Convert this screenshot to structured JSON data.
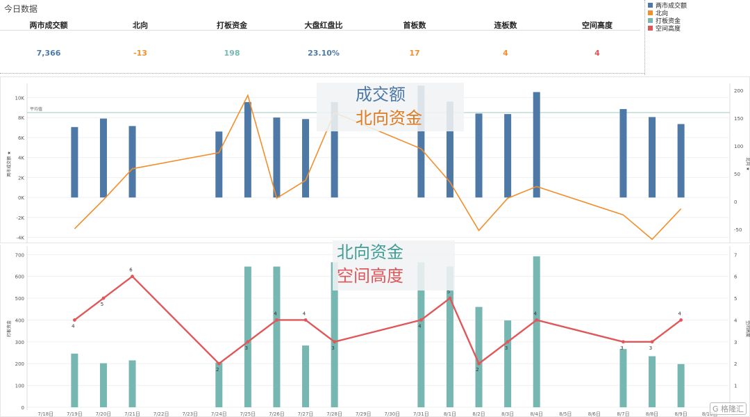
{
  "page_title": "今日数据",
  "kpis": [
    {
      "label": "两市成交额",
      "value": "7,366",
      "color": "#4e79a7"
    },
    {
      "label": "北向",
      "value": "-13",
      "color": "#f28e2b"
    },
    {
      "label": "打板资金",
      "value": "198",
      "color": "#76b7b2"
    },
    {
      "label": "大盘红盘比",
      "value": "23.10%",
      "color": "#4e79a7"
    },
    {
      "label": "首板数",
      "value": "17",
      "color": "#f28e2b"
    },
    {
      "label": "连板数",
      "value": "4",
      "color": "#f28e2b"
    },
    {
      "label": "空间高度",
      "value": "4",
      "color": "#e15759"
    }
  ],
  "legend": [
    {
      "label": "两市成交额",
      "color": "#4e79a7"
    },
    {
      "label": "北向",
      "color": "#f28e2b"
    },
    {
      "label": "打板资金",
      "color": "#76b7b2"
    },
    {
      "label": "空间高度",
      "color": "#e15759"
    }
  ],
  "overlays": {
    "top_line1": "成交额",
    "top_line2": "北向资金",
    "bottom_line1": "北向资金",
    "bottom_line2": "空间高度"
  },
  "watermark": "G 格隆汇",
  "chart_data": [
    {
      "type": "bar",
      "categories": [
        "7/18日",
        "7/19日",
        "7/20日",
        "7/21日",
        "7/22日",
        "7/23日",
        "7/24日",
        "7/25日",
        "7/26日",
        "7/27日",
        "7/28日",
        "7/29日",
        "7/30日",
        "7/31日",
        "8/1日",
        "8/2日",
        "8/3日",
        "8/4日",
        "8/5日",
        "8/6日",
        "8/7日",
        "8/8日",
        "8/9日",
        "8/10日"
      ],
      "y_ticks": [
        "10K",
        "8K",
        "6K",
        "4K",
        "2K",
        "0K",
        "-2K",
        "-4K"
      ],
      "y2_ticks": [
        "200",
        "150",
        "100",
        "50",
        "0",
        "-50"
      ],
      "ylabel": "两市成交额 ★",
      "y2label": "北向 ★",
      "ylim": [
        -4300,
        11000
      ],
      "y2lim": [
        -70,
        205
      ],
      "reference_line": {
        "label": "平均值",
        "value": 8500
      },
      "series": [
        {
          "name": "两市成交额",
          "kind": "bar",
          "color": "#4e79a7",
          "values": [
            null,
            7050,
            7900,
            7150,
            null,
            null,
            6600,
            9550,
            8000,
            7850,
            9550,
            null,
            null,
            11200,
            9600,
            8400,
            8350,
            10550,
            null,
            null,
            8850,
            8050,
            7350,
            null
          ]
        },
        {
          "name": "北向",
          "kind": "line",
          "color": "#f28e2b",
          "values": [
            null,
            -49,
            3,
            59,
            null,
            null,
            88,
            191,
            6,
            38,
            160,
            null,
            null,
            95,
            35,
            -52,
            6,
            27,
            null,
            null,
            -24,
            -68,
            -13,
            null
          ]
        }
      ]
    },
    {
      "type": "bar",
      "categories": [
        "7/18日",
        "7/19日",
        "7/20日",
        "7/21日",
        "7/22日",
        "7/23日",
        "7/24日",
        "7/25日",
        "7/26日",
        "7/27日",
        "7/28日",
        "7/29日",
        "7/30日",
        "7/31日",
        "8/1日",
        "8/2日",
        "8/3日",
        "8/4日",
        "8/5日",
        "8/6日",
        "8/7日",
        "8/8日",
        "8/9日",
        "8/10日"
      ],
      "y_ticks": [
        "700",
        "600",
        "500",
        "400",
        "300",
        "200",
        "100",
        "0"
      ],
      "y2_ticks": [
        "7",
        "6",
        "5",
        "4",
        "3",
        "2",
        "1"
      ],
      "ylabel": "打板资金",
      "y2label": "空间高度",
      "ylim": [
        0,
        720
      ],
      "y2lim": [
        0,
        7.2
      ],
      "series": [
        {
          "name": "打板资金",
          "kind": "bar",
          "color": "#76b7b2",
          "values": [
            null,
            246,
            202,
            215,
            null,
            null,
            205,
            645,
            645,
            283,
            665,
            null,
            null,
            665,
            645,
            460,
            398,
            692,
            null,
            null,
            267,
            234,
            198,
            null
          ]
        },
        {
          "name": "空间高度",
          "kind": "line",
          "color": "#e15759",
          "values": [
            null,
            4,
            5,
            6,
            null,
            null,
            2,
            3,
            4,
            4,
            3,
            null,
            null,
            4,
            5,
            2,
            3,
            4,
            null,
            null,
            3,
            3,
            4,
            null
          ],
          "labels": [
            "",
            "4",
            "5",
            "6",
            "",
            "",
            "2",
            "3",
            "4",
            "4",
            "3",
            "",
            "",
            "4",
            "5",
            "2",
            "3",
            "4",
            "",
            "",
            "3",
            "3",
            "4",
            ""
          ]
        }
      ]
    }
  ]
}
